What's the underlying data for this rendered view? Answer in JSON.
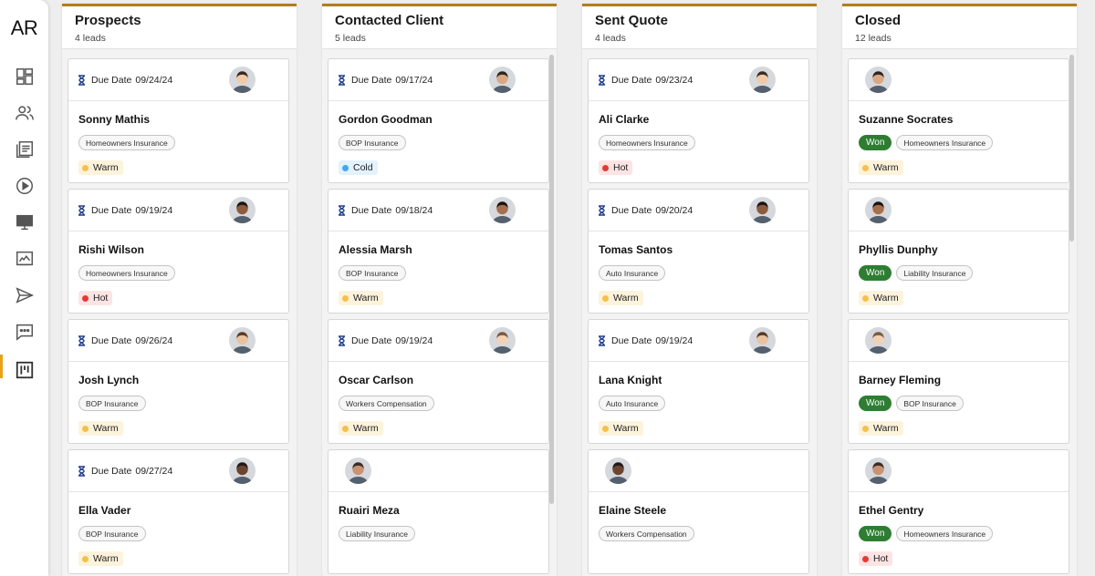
{
  "app": {
    "logo": "AR"
  },
  "nav": [
    {
      "name": "dashboard-icon"
    },
    {
      "name": "contacts-icon"
    },
    {
      "name": "documents-icon"
    },
    {
      "name": "play-icon"
    },
    {
      "name": "monitor-icon"
    },
    {
      "name": "signature-icon"
    },
    {
      "name": "send-icon"
    },
    {
      "name": "chat-icon"
    },
    {
      "name": "kanban-icon",
      "active": true
    }
  ],
  "colors": {
    "accent": "#e8a21a",
    "column_border": "#b07d1f",
    "won": "#2e7d32",
    "warm": "#f5c04a",
    "cold": "#42a5f5",
    "hot": "#e53935"
  },
  "due_label": "Due Date",
  "won_label": "Won",
  "columns": [
    {
      "title": "Prospects",
      "count": "4 leads",
      "cards": [
        {
          "due": "09/24/24",
          "name": "Sonny Mathis",
          "insurance": "Homeowners Insurance",
          "temp": "Warm"
        },
        {
          "due": "09/19/24",
          "name": "Rishi Wilson",
          "insurance": "Homeowners Insurance",
          "temp": "Hot"
        },
        {
          "due": "09/26/24",
          "name": "Josh Lynch",
          "insurance": "BOP Insurance",
          "temp": "Warm"
        },
        {
          "due": "09/27/24",
          "name": "Ella Vader",
          "insurance": "BOP Insurance",
          "temp": "Warm"
        }
      ]
    },
    {
      "title": "Contacted Client",
      "count": "5 leads",
      "cards": [
        {
          "due": "09/17/24",
          "name": "Gordon Goodman",
          "insurance": "BOP Insurance",
          "temp": "Cold"
        },
        {
          "due": "09/18/24",
          "name": "Alessia Marsh",
          "insurance": "BOP Insurance",
          "temp": "Warm"
        },
        {
          "due": "09/19/24",
          "name": "Oscar Carlson",
          "insurance": "Workers Compensation",
          "temp": "Warm"
        },
        {
          "due": "",
          "name": "Ruairi Meza",
          "insurance": "Liability Insurance",
          "temp": ""
        }
      ]
    },
    {
      "title": "Sent Quote",
      "count": "4 leads",
      "cards": [
        {
          "due": "09/23/24",
          "name": "Ali Clarke",
          "insurance": "Homeowners Insurance",
          "temp": "Hot"
        },
        {
          "due": "09/20/24",
          "name": "Tomas Santos",
          "insurance": "Auto Insurance",
          "temp": "Warm"
        },
        {
          "due": "09/19/24",
          "name": "Lana Knight",
          "insurance": "Auto Insurance",
          "temp": "Warm"
        },
        {
          "due": "",
          "name": "Elaine Steele",
          "insurance": "Workers Compensation",
          "temp": ""
        }
      ]
    },
    {
      "title": "Closed",
      "count": "12 leads",
      "cards": [
        {
          "due": "",
          "won": true,
          "name": "Suzanne Socrates",
          "insurance": "Homeowners Insurance",
          "temp": "Warm"
        },
        {
          "due": "",
          "won": true,
          "name": "Phyllis Dunphy",
          "insurance": "Liability Insurance",
          "temp": "Warm"
        },
        {
          "due": "",
          "won": true,
          "name": "Barney Fleming",
          "insurance": "BOP Insurance",
          "temp": "Warm"
        },
        {
          "due": "",
          "won": true,
          "name": "Ethel Gentry",
          "insurance": "Homeowners Insurance",
          "temp": "Hot"
        }
      ]
    }
  ]
}
